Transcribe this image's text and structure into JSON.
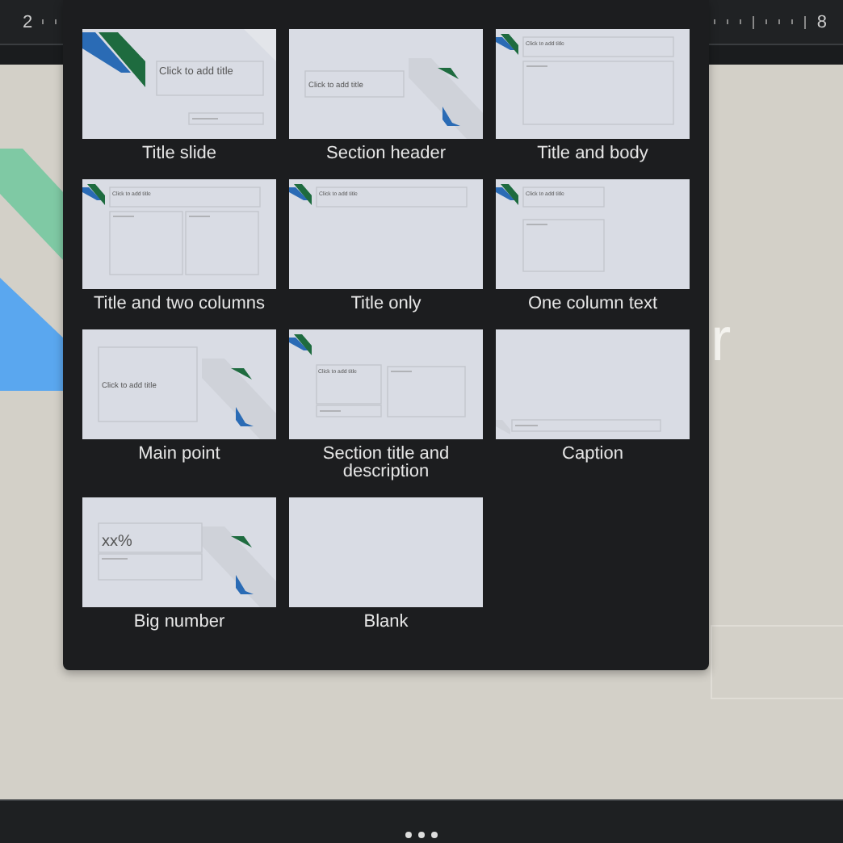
{
  "ruler": {
    "start_label": "2",
    "end_label": "8"
  },
  "slide": {
    "title_fragment": "r"
  },
  "layouts": [
    {
      "kind": "title_slide",
      "name": "Title slide",
      "title_text": "Click to add title"
    },
    {
      "kind": "section_header",
      "name": "Section header",
      "title_text": "Click to add title"
    },
    {
      "kind": "title_body",
      "name": "Title and body",
      "title_text": "Click to add title"
    },
    {
      "kind": "two_columns",
      "name": "Title and two columns",
      "title_text": "Click to add title"
    },
    {
      "kind": "title_only",
      "name": "Title only",
      "title_text": "Click to add title"
    },
    {
      "kind": "one_column",
      "name": "One column text",
      "title_text": "Click to add title"
    },
    {
      "kind": "main_point",
      "name": "Main point",
      "title_text": "Click to add title"
    },
    {
      "kind": "section_description",
      "name": "Section title and description",
      "title_text": "Click to add title"
    },
    {
      "kind": "caption",
      "name": "Caption"
    },
    {
      "kind": "big_number",
      "name": "Big number",
      "title_text": "xx%"
    },
    {
      "kind": "blank",
      "name": "Blank"
    }
  ]
}
